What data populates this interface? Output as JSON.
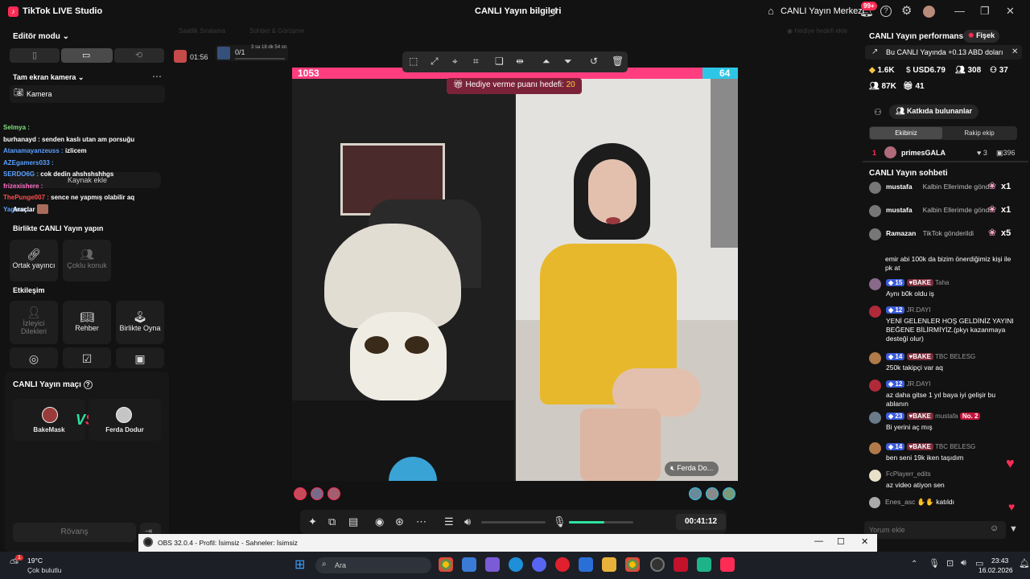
{
  "titlebar": {
    "app_name": "TikTok LIVE Studio",
    "center_title": "CANLI Yayın bilgileri",
    "center_link": "CANLI Yayın Merkezi",
    "notif_badge": "99+"
  },
  "left": {
    "editor_mode": "Editör modu",
    "camera_section": "Tam ekran kamera",
    "camera_item": "Kamera",
    "add_source": "Kaynak ekle",
    "tools": "Araçlar",
    "chat_lines": [
      {
        "user": "Selmya :",
        "msg": "",
        "color": "#7ee07e"
      },
      {
        "user": "burhanayd :",
        "msg": "senden kaslı utan am porsuğu",
        "color": "#ffffff"
      },
      {
        "user": "Atanamayanzeuss :",
        "msg": "izlicem",
        "color": "#5aa0ff"
      },
      {
        "user": "AZEgamers033 :",
        "msg": "",
        "color": "#5aa0ff"
      },
      {
        "user": "SERDO6G :",
        "msg": "cok dedin ahshshshhgs",
        "color": "#5aa0ff"
      },
      {
        "user": "frizexishere :",
        "msg": "",
        "color": "#ff6ec7"
      },
      {
        "user": "ThePunge007 :",
        "msg": "sence ne yapmış olabilir aq",
        "color": "#ff4d4d"
      },
      {
        "user": "Yagmur...",
        "msg": "",
        "color": "#5aa0ff"
      }
    ],
    "together_title": "Birlikte CANLI Yayın yapın",
    "together_tiles": [
      "Ortak yayıncı",
      "Çoklu konuk"
    ],
    "interaction_title": "Etkileşim",
    "interaction_tiles": [
      "İzleyici Dilekleri",
      "Rehber",
      "Birlikte Oyna"
    ],
    "match_title": "CANLI Yayın maçı",
    "match_left": "BakeMask",
    "match_right": "Ferda Dodur",
    "rematch": "Rövanş"
  },
  "topstrip": {
    "left_faded": "Saatlik Sıralama",
    "mid_faded": "Sohbet & Görüşme",
    "right_faded": "Hediye hedefi ekle",
    "timer": "01:56",
    "progress": "0/1",
    "progress_sub": "3 sa 18 dk 54 sn"
  },
  "stage": {
    "score_left": "1053",
    "score_right": "64",
    "gift_goal_label": "Hediye verme puanı hedefi:",
    "gift_goal_value": "20",
    "right_name_tag": "Ferda Do...",
    "time": "00:41:12",
    "mic_level": 0.55
  },
  "right": {
    "perf_title": "CANLI Yayın performansı",
    "fisek": "Fişek",
    "earnings_banner": "Bu CANLI Yayında +0.13 ABD doları",
    "stats": {
      "likes": "1.6K",
      "usd": "USD6.79",
      "viewers": "308",
      "followers": "37",
      "views": "87K",
      "gifters": "41"
    },
    "contributors_btn": "Katkıda bulunanlar",
    "tab_team": "Ekibiniz",
    "tab_rival": "Rakip ekip",
    "top_rank": "1",
    "top_name": "primesGALA",
    "top_likes": "3",
    "top_gifts": "396",
    "chat_title": "CANLI Yayın sohbeti",
    "gift_rows": [
      {
        "name": "mustafa",
        "text": "Kalbin Ellerimde gönd",
        "count": "x1"
      },
      {
        "name": "mustafa",
        "text": "Kalbin Ellerimde gönd",
        "count": "x1"
      },
      {
        "name": "Ramazan",
        "text": "TikTok gönderildi",
        "count": "x5"
      }
    ],
    "trunc_msg": "emir abi 100k da bizim önerdiğimiz kişi ile pk at",
    "messages": [
      {
        "lvl": "15",
        "badge": "BAKE",
        "name": "Taha",
        "msg": "Aynı b0k oldu iş"
      },
      {
        "lvl": "12",
        "badge": "",
        "name": "JR.DAYI",
        "msg": "YENİ GELENLER HOŞ GELDİNİZ YAYINI BEĞENE BİLİRMİYİZ.(pkyı kazanmaya desteği olur)"
      },
      {
        "lvl": "14",
        "badge": "BAKE",
        "name": "TBC BELESG",
        "msg": "250k takipçi var aq"
      },
      {
        "lvl": "12",
        "badge": "",
        "name": "JR.DAYI",
        "msg": "az daha gitse 1 yıl baya iyi gelişir bu ablanın"
      },
      {
        "lvl": "23",
        "badge": "BAKE",
        "name": "mustafa",
        "extra": "No. 2",
        "msg": "Bi yerini aç mış"
      },
      {
        "lvl": "14",
        "badge": "BAKE",
        "name": "TBC BELESG",
        "msg": "ben seni 19k iken taşıdım"
      },
      {
        "lvl": "",
        "badge": "",
        "name": "FcPlayerr_edits",
        "msg": "az video atiyon sen"
      }
    ],
    "joined_name": "Enes_asc",
    "joined_text": "katıldı",
    "comment_placeholder": "Yorum ekle"
  },
  "obs_bar": {
    "title": "OBS 32.0.4 - Profil: İsimsiz - Sahneler: İsimsiz"
  },
  "taskbar": {
    "temp": "19°C",
    "weather": "Çok bulutlu",
    "search": "Ara",
    "time": "23:43",
    "date": "16.02.2026",
    "weather_badge": "1"
  },
  "colors": {
    "accent": "#fe2c55",
    "score_pink": "#ff3d7f",
    "score_blue": "#2ec6e6",
    "green": "#2de3a0"
  }
}
